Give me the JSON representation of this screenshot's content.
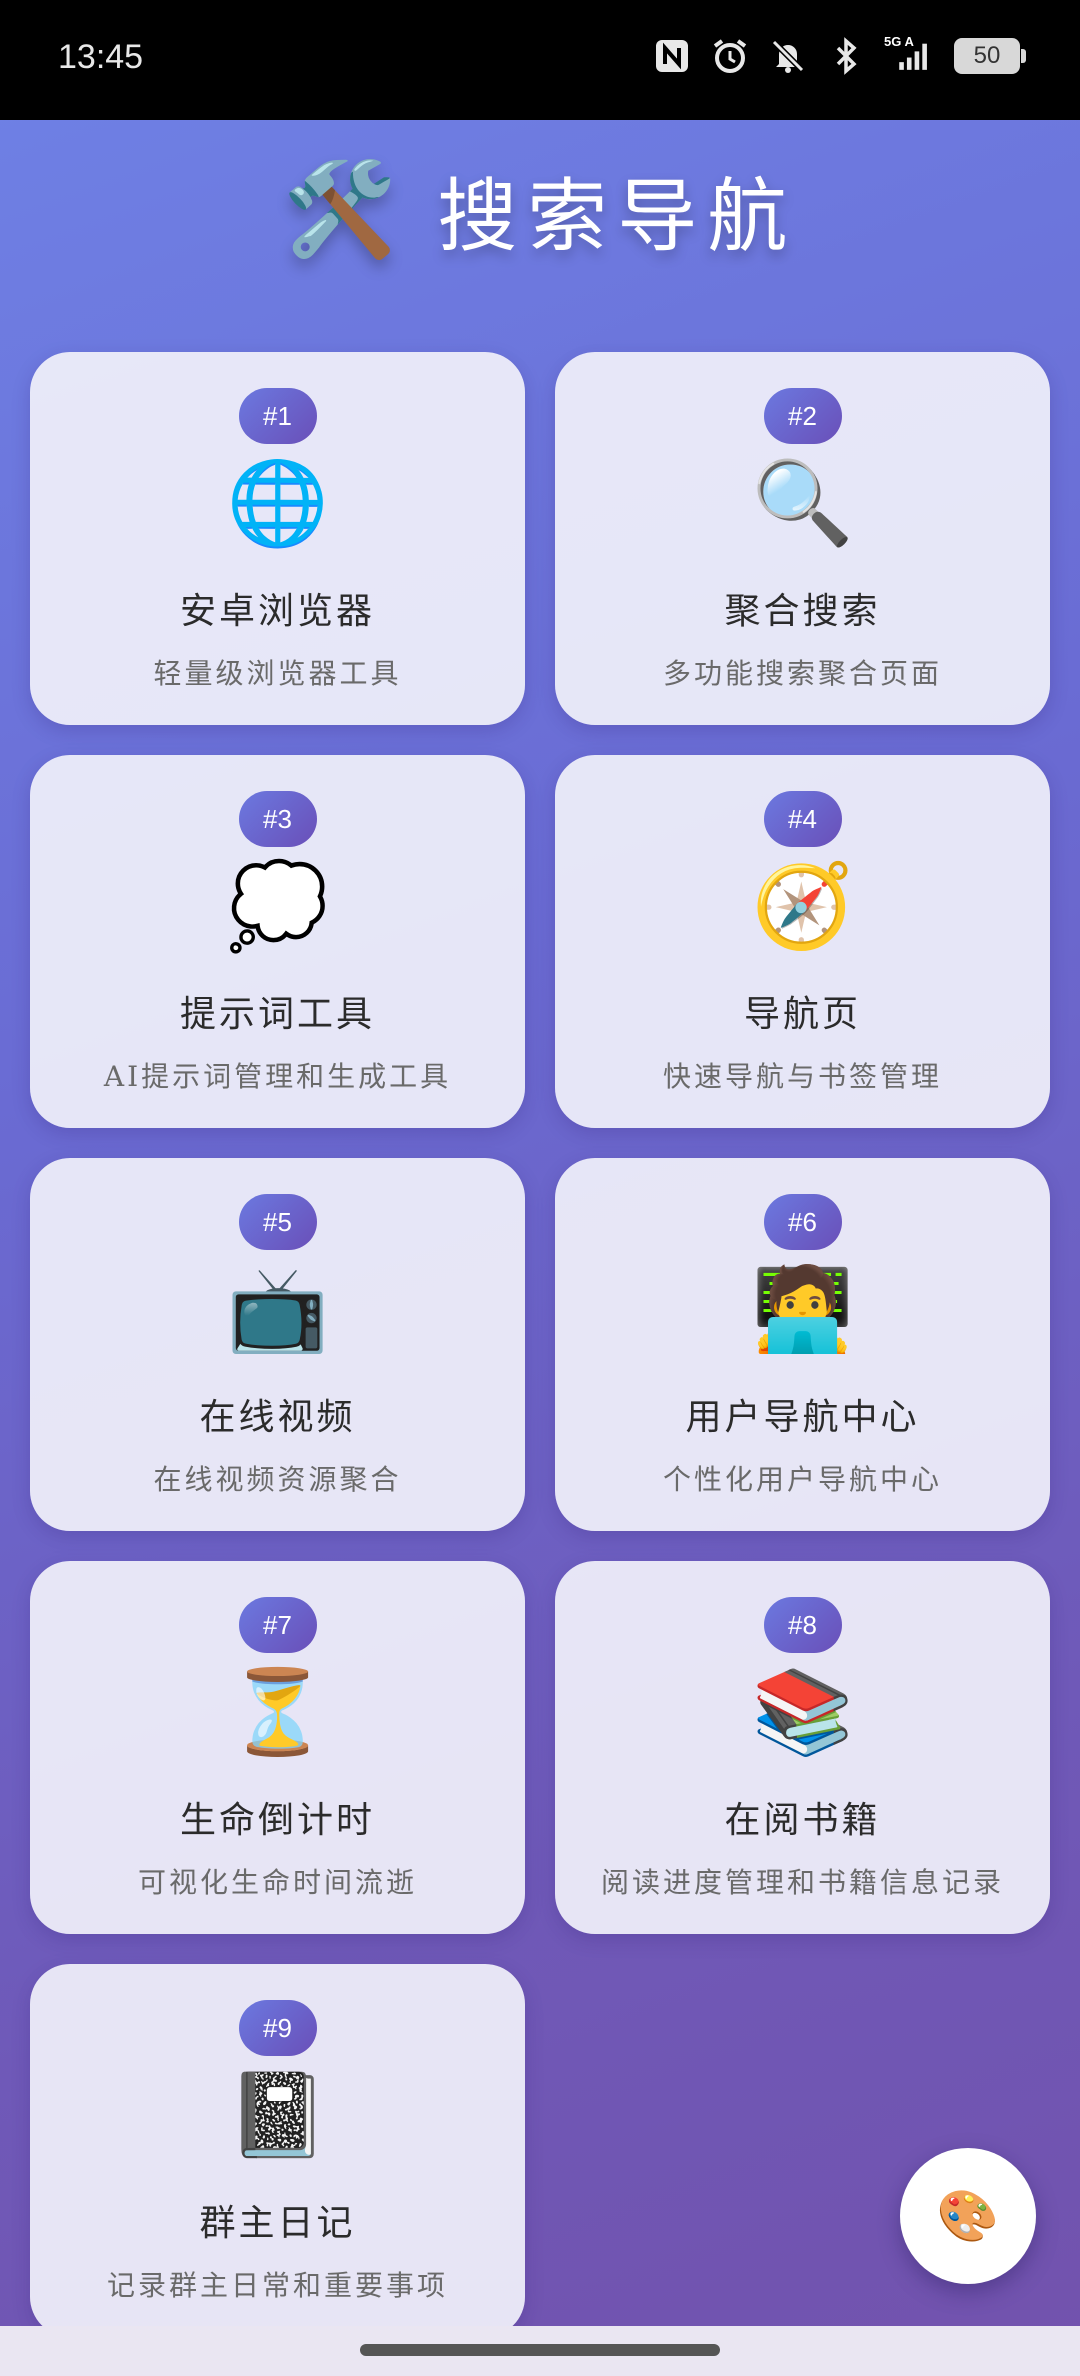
{
  "status_bar": {
    "time": "13:45",
    "network_label": "5G A",
    "battery": "50",
    "icons": [
      "nfc-icon",
      "alarm-icon",
      "bell-muted-icon",
      "bluetooth-icon",
      "signal-icon",
      "battery-icon"
    ]
  },
  "header": {
    "icon": "🛠️",
    "icon_name": "tools-icon",
    "title": "搜索导航"
  },
  "cards": [
    {
      "badge": "#1",
      "icon": "🌐",
      "icon_name": "globe-icon",
      "title": "安卓浏览器",
      "desc": "轻量级浏览器工具"
    },
    {
      "badge": "#2",
      "icon": "🔍",
      "icon_name": "magnifier-icon",
      "title": "聚合搜索",
      "desc": "多功能搜索聚合页面"
    },
    {
      "badge": "#3",
      "icon": "💭",
      "icon_name": "thought-bubble-icon",
      "title": "提示词工具",
      "desc": "AI提示词管理和生成工具"
    },
    {
      "badge": "#4",
      "icon": "🧭",
      "icon_name": "compass-icon",
      "title": "导航页",
      "desc": "快速导航与书签管理"
    },
    {
      "badge": "#5",
      "icon": "📺",
      "icon_name": "tv-icon",
      "title": "在线视频",
      "desc": "在线视频资源聚合"
    },
    {
      "badge": "#6",
      "icon": "🧑‍💻",
      "icon_name": "technologist-icon",
      "title": "用户导航中心",
      "desc": "个性化用户导航中心"
    },
    {
      "badge": "#7",
      "icon": "⏳",
      "icon_name": "hourglass-icon",
      "title": "生命倒计时",
      "desc": "可视化生命时间流逝"
    },
    {
      "badge": "#8",
      "icon": "📚",
      "icon_name": "books-icon",
      "title": "在阅书籍",
      "desc": "阅读进度管理和书籍信息记录"
    },
    {
      "badge": "#9",
      "icon": "📓",
      "icon_name": "notebook-icon",
      "title": "群主日记",
      "desc": "记录群主日常和重要事项"
    }
  ],
  "fab": {
    "icon": "🎨",
    "icon_name": "palette-icon"
  }
}
